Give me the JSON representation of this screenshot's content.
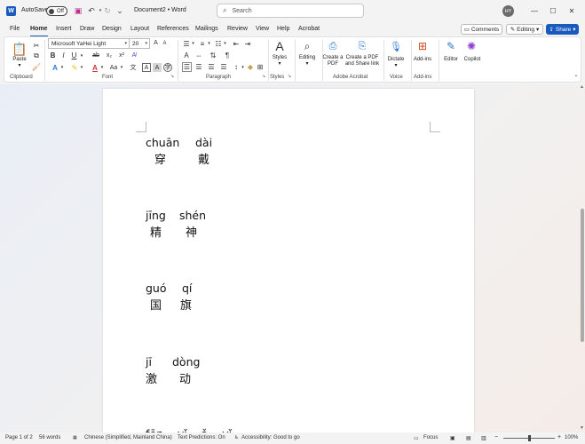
{
  "titlebar": {
    "autosave_label": "AutoSave",
    "autosave_state": "Off",
    "doc_title": "Document2 • Word",
    "search_placeholder": "Search",
    "avatar_initials": "HY"
  },
  "tabs": [
    "File",
    "Home",
    "Insert",
    "Draw",
    "Design",
    "Layout",
    "References",
    "Mailings",
    "Review",
    "View",
    "Help",
    "Acrobat"
  ],
  "active_tab": "Home",
  "actions": {
    "comments": "Comments",
    "editing": "Editing",
    "share": "Share"
  },
  "ribbon": {
    "clipboard": {
      "paste": "Paste",
      "label": "Clipboard"
    },
    "font": {
      "name": "Microsoft YaHei Light",
      "size": "20",
      "label": "Font"
    },
    "paragraph": {
      "label": "Paragraph"
    },
    "styles": {
      "styles_btn": "Styles",
      "label": "Styles"
    },
    "editing": {
      "btn": "Editing"
    },
    "acrobat": {
      "create_pdf": "Create a PDF",
      "create_share": "Create a PDF and Share link",
      "label": "Adobe Acrobat"
    },
    "voice": {
      "dictate": "Dictate",
      "label": "Voice"
    },
    "addins": {
      "btn": "Add-ins",
      "label": "Add-ins"
    },
    "editor": "Editor",
    "copilot": "Copilot"
  },
  "document": {
    "entries": [
      {
        "pinyin_a": "chuān",
        "pinyin_b": "dài",
        "hanzi_a": "穿",
        "hanzi_b": "戴"
      },
      {
        "pinyin_a": "jīng",
        "pinyin_b": "shén",
        "hanzi_a": "精",
        "hanzi_b": "神"
      },
      {
        "pinyin_a": "guó",
        "pinyin_b": "qí",
        "hanzi_a": "国",
        "hanzi_b": "旗"
      },
      {
        "pinyin_a": "jī",
        "pinyin_b": "dòng",
        "hanzi_a": "激",
        "hanzi_b": "动"
      }
    ],
    "partial_line": "fēn    yǐ    ǎ    yǐ"
  },
  "statusbar": {
    "page": "Page 1 of 2",
    "words": "56 words",
    "language": "Chinese (Simplified, Mainland China)",
    "text_predictions": "Text Predictions: On",
    "accessibility": "Accessibility: Good to go",
    "focus": "Focus",
    "zoom": "100%"
  }
}
